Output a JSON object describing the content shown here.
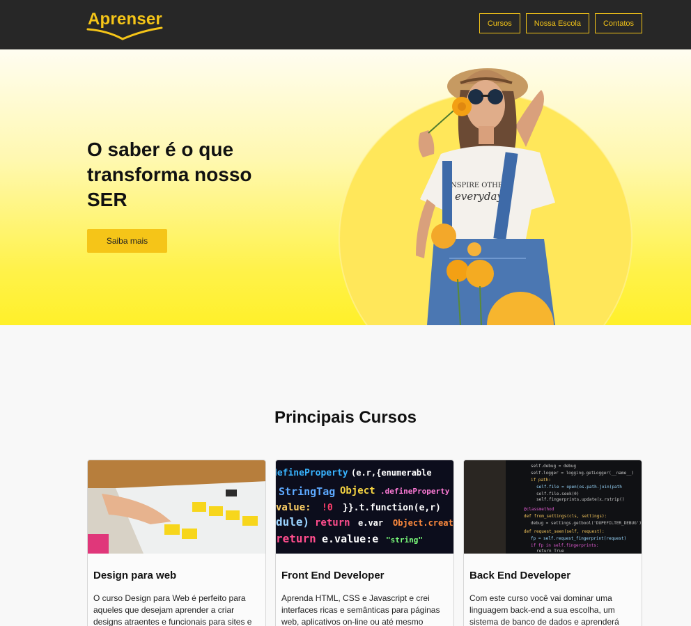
{
  "header": {
    "logo_text": "Aprenser",
    "nav": [
      "Cursos",
      "Nossa Escola",
      "Contatos"
    ]
  },
  "hero": {
    "title": "O saber é o que transforma nosso SER",
    "cta_label": "Saiba mais",
    "shirt_text_1": "INSPIRE OTHERS",
    "shirt_text_2": "everyday"
  },
  "courses": {
    "title": "Principais Cursos",
    "items": [
      {
        "title": "Design para web",
        "description": "O curso Design para Web é perfeito para aqueles que desejam aprender a criar designs atraentes e funcionais para sites e"
      },
      {
        "title": "Front End Developer",
        "description": "Aprenda HTML, CSS e Javascript e crei interfaces ricas e semânticas para páginas web, aplicativos on-line ou até mesmo"
      },
      {
        "title": "Back End Developer",
        "description": "Com este curso você vai dominar uma linguagem back-end a sua escolha, um sistema de banco de dados e aprenderá"
      }
    ]
  },
  "colors": {
    "accent": "#f5c518",
    "header_bg": "#272727",
    "page_bg": "#f8f8f8"
  }
}
